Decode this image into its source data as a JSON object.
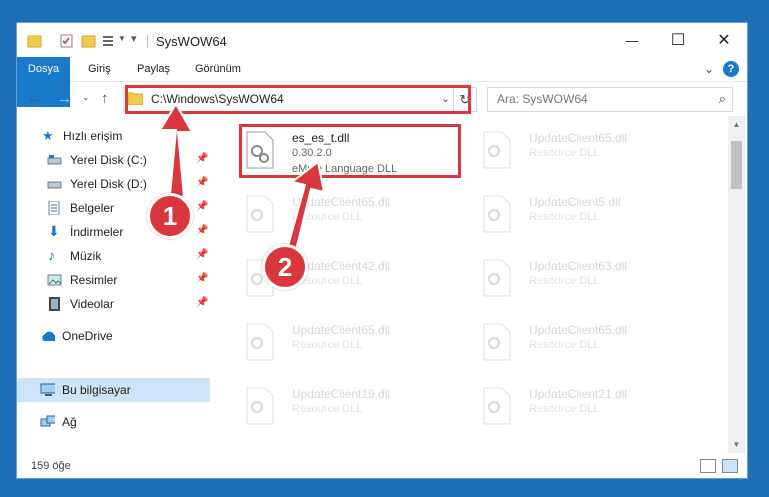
{
  "window": {
    "title": "SysWOW64",
    "controls": {
      "minimize": "—",
      "maximize": "☐",
      "close": "✕"
    }
  },
  "ribbon": {
    "tabs": [
      {
        "label": "Dosya"
      },
      {
        "label": "Giriş"
      },
      {
        "label": "Paylaş"
      },
      {
        "label": "Görünüm"
      }
    ],
    "help": "?"
  },
  "address": {
    "path": "C:\\Windows\\SysWOW64",
    "search_placeholder": "Ara: SysWOW64"
  },
  "nav": {
    "items": [
      {
        "label": "Hızlı erişim",
        "icon": "star-icon",
        "pinned": false
      },
      {
        "label": "Yerel Disk (C:)",
        "icon": "drive-icon",
        "pinned": true
      },
      {
        "label": "Yerel Disk (D:)",
        "icon": "drive-icon",
        "pinned": true
      },
      {
        "label": "Belgeler",
        "icon": "documents-icon",
        "pinned": true
      },
      {
        "label": "İndirmeler",
        "icon": "downloads-icon",
        "pinned": true
      },
      {
        "label": "Müzik",
        "icon": "music-icon",
        "pinned": true
      },
      {
        "label": "Resimler",
        "icon": "pictures-icon",
        "pinned": true
      },
      {
        "label": "Videolar",
        "icon": "videos-icon",
        "pinned": true
      },
      {
        "label": "OneDrive",
        "icon": "cloud-icon",
        "pinned": false
      },
      {
        "label": "Bu bilgisayar",
        "icon": "computer-icon",
        "pinned": false,
        "selected": true
      },
      {
        "label": "Ağ",
        "icon": "network-icon",
        "pinned": false
      }
    ]
  },
  "files": [
    {
      "name": "es_es_t.dll",
      "version": "0.30.2.0",
      "description": "eMule Language DLL",
      "highlighted": true
    },
    {
      "name": "UpdateClient65.dll",
      "description": "Resource DLL"
    },
    {
      "name": "UpdateClient65.dll",
      "description": "Resource DLL"
    },
    {
      "name": "UpdateClient5.dll",
      "description": "Resource DLL"
    },
    {
      "name": "UpdateClient42.dll",
      "description": "Resource DLL"
    },
    {
      "name": "UpdateClient63.dll",
      "description": "Resource DLL"
    },
    {
      "name": "UpdateClient65.dll",
      "description": "Resource DLL"
    },
    {
      "name": "UpdateClient65.dll",
      "description": "Resource DLL"
    },
    {
      "name": "UpdateClient19.dll",
      "description": "Resource DLL"
    },
    {
      "name": "UpdateClient21.dll",
      "description": "Resource DLL"
    }
  ],
  "status": {
    "count": "159 öğe"
  },
  "annotations": {
    "step1": "1",
    "step2": "2"
  },
  "colors": {
    "accent": "#1979ca",
    "highlight": "#d9363e",
    "desktop": "#1d6fb8"
  }
}
